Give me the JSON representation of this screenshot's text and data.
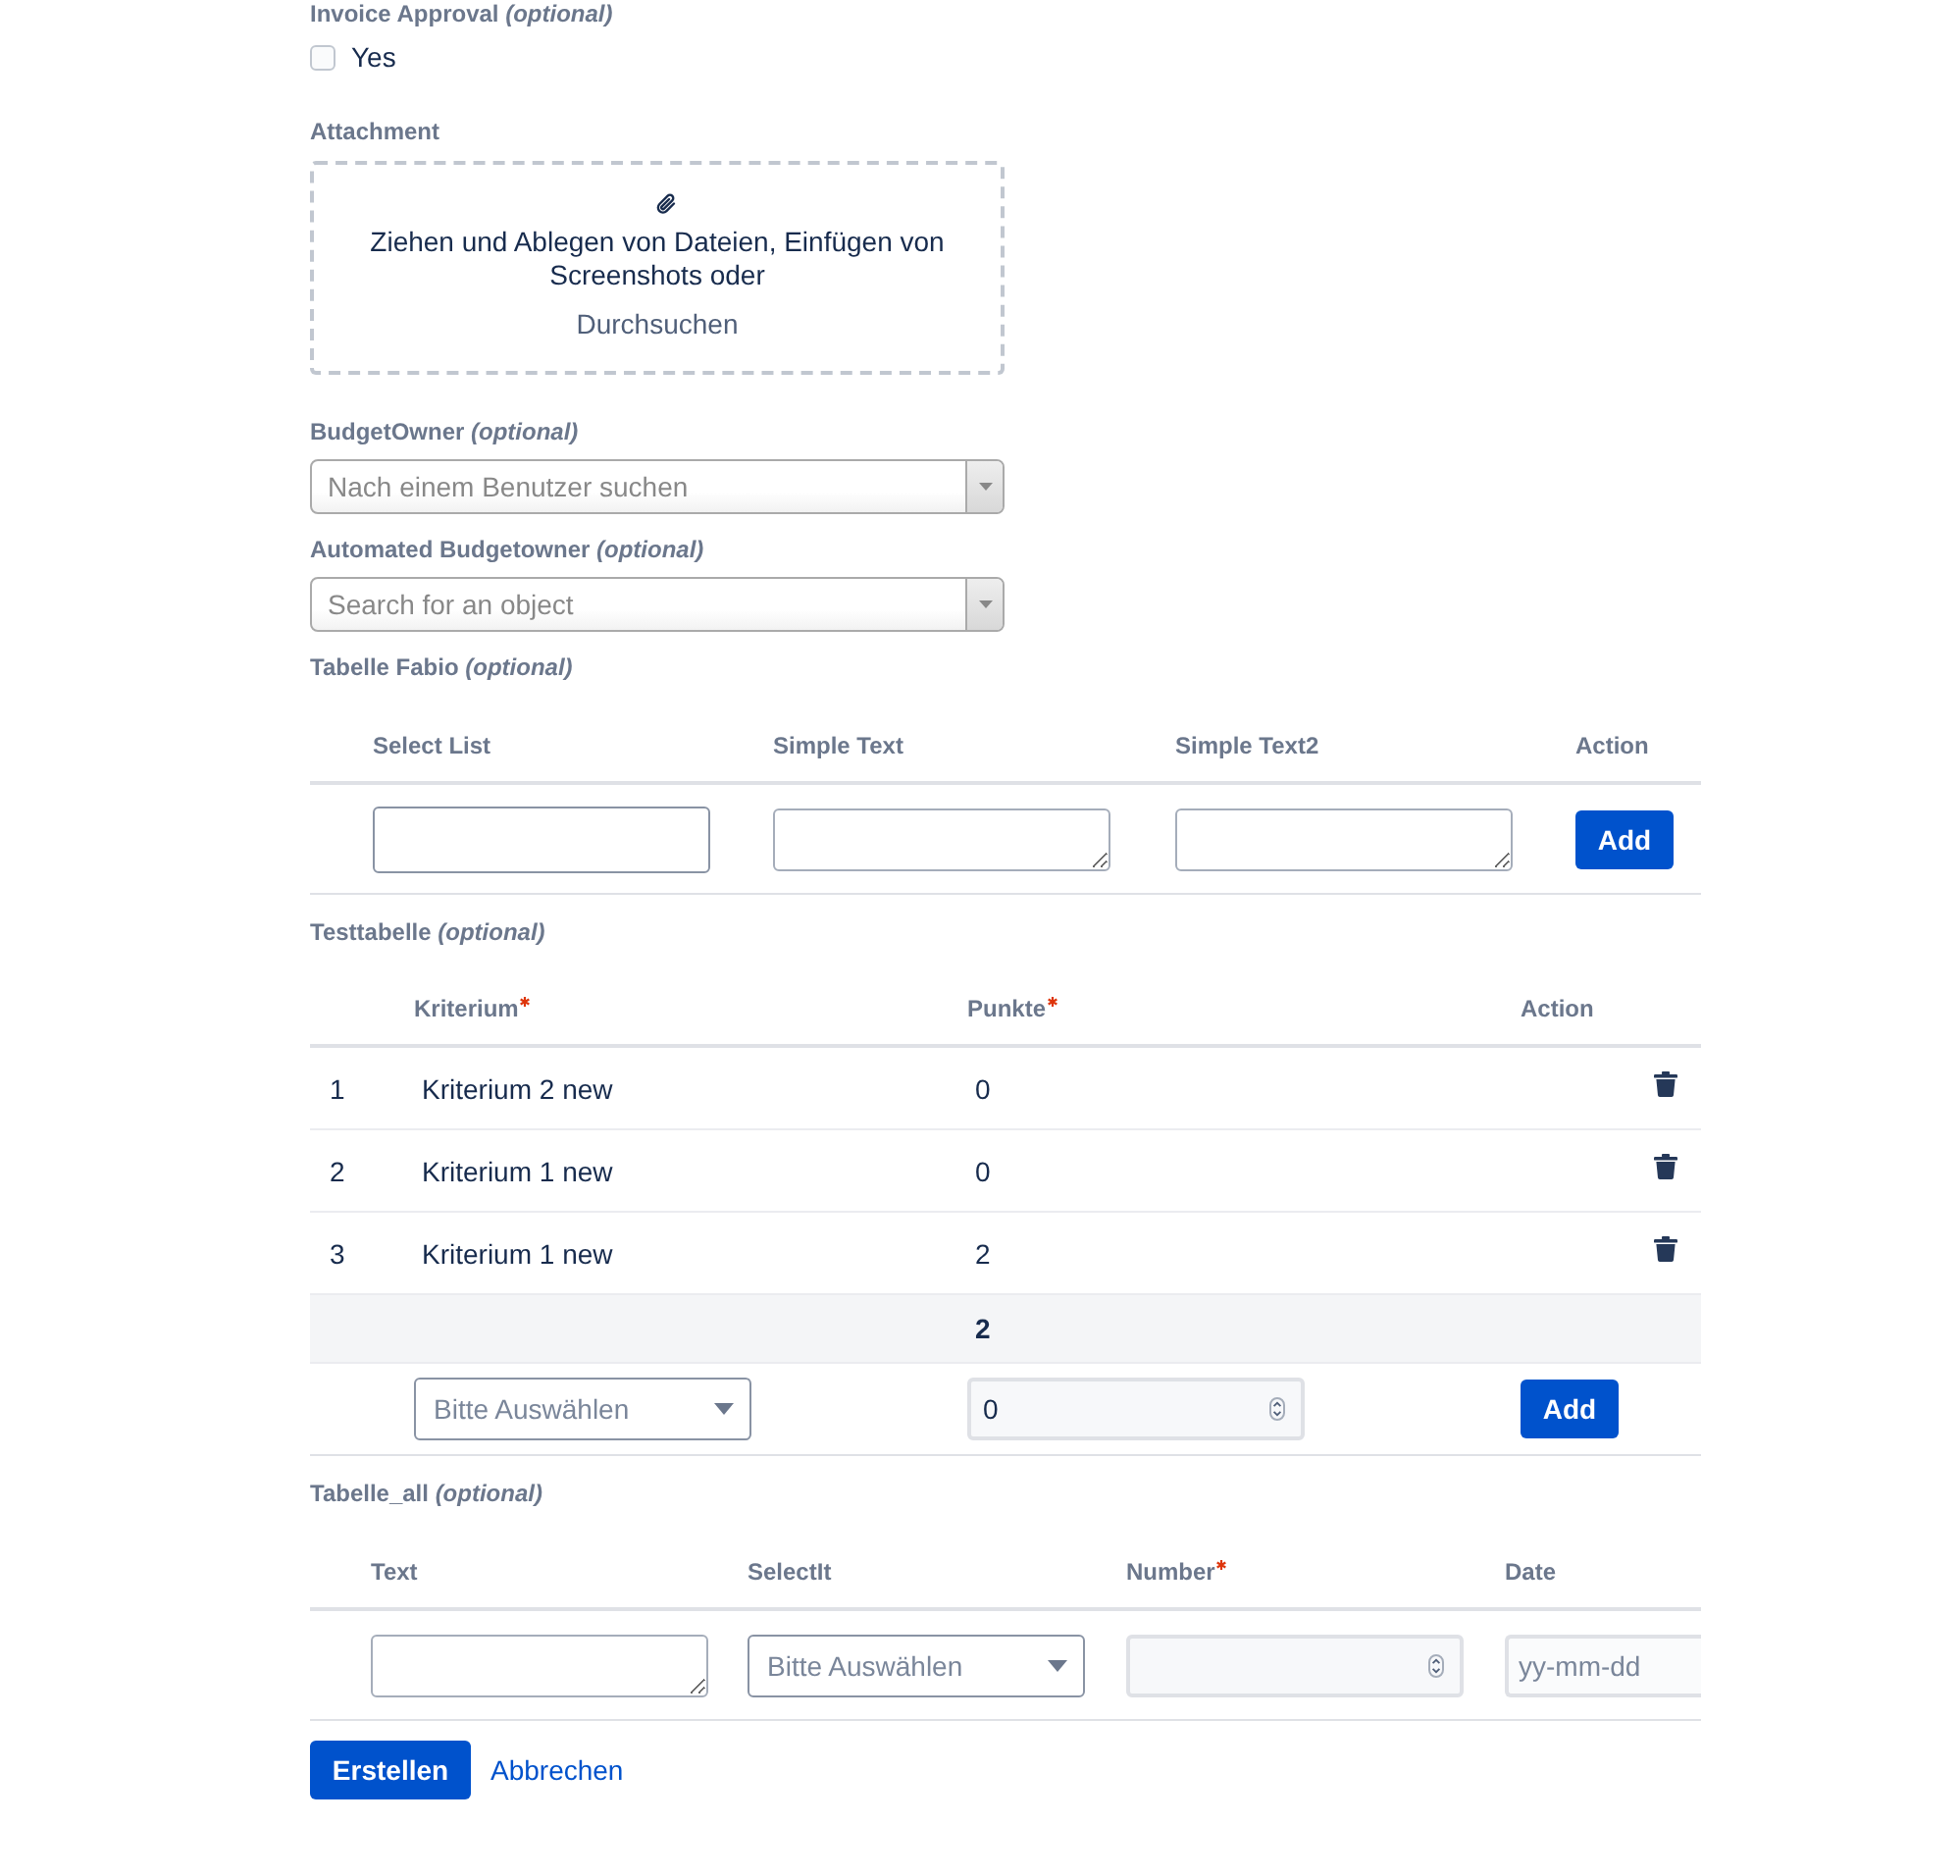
{
  "invoice_approval": {
    "label": "Invoice Approval *(optional)*",
    "option": {
      "label": "Yes",
      "checked": false
    }
  },
  "attachment": {
    "label": "Attachment",
    "drop_text": "Ziehen und Ablegen von Dateien, Einfügen von Screenshots oder",
    "browse_link": "Durchsuchen"
  },
  "budget_owner": {
    "label": "BudgetOwner *(optional)*",
    "placeholder": "Nach einem Benutzer suchen"
  },
  "automated_budgetowner": {
    "label": "Automated Budgetowner *(optional)*",
    "placeholder": "Search for an object"
  },
  "tabelle_fabio": {
    "label": "Tabelle Fabio *(optional)*",
    "columns": [
      {
        "title": "Select List",
        "required": false
      },
      {
        "title": "Simple Text",
        "required": false
      },
      {
        "title": "Simple Text2",
        "required": false
      },
      {
        "title": "Action",
        "required": false
      }
    ],
    "new_row": {
      "cells": [
        {
          "kind": "input"
        },
        {
          "kind": "textarea"
        },
        {
          "kind": "textarea"
        }
      ],
      "add_button": "Add"
    }
  },
  "testtabelle": {
    "label": "Testtabelle *(optional)*",
    "columns": [
      {
        "title": "Kriterium",
        "required": true
      },
      {
        "title": "Punkte",
        "required": true
      },
      {
        "title": "Action",
        "required": false
      }
    ],
    "rows": [
      {
        "index": "1",
        "criterion": "Kriterium 2 new",
        "points": "0"
      },
      {
        "index": "2",
        "criterion": "Kriterium 1 new",
        "points": "0"
      },
      {
        "index": "3",
        "criterion": "Kriterium 1 new",
        "points": "2"
      }
    ],
    "total": "2",
    "new_row": {
      "cells": [
        {
          "kind": "select",
          "placeholder": "Bitte Auswählen"
        },
        {
          "kind": "number",
          "value": "0"
        }
      ],
      "add_button": "Add"
    }
  },
  "tabelle_all": {
    "label": "Tabelle_all *(optional)*",
    "columns": [
      {
        "title": "Text",
        "required": false
      },
      {
        "title": "SelectIt",
        "required": false
      },
      {
        "title": "Number",
        "required": true
      },
      {
        "title": "Date",
        "required": false
      }
    ],
    "new_row": {
      "cells": [
        {
          "kind": "textarea"
        },
        {
          "kind": "select",
          "placeholder": "Bitte Auswählen"
        },
        {
          "kind": "number"
        },
        {
          "kind": "date",
          "placeholder": "yy-mm-dd"
        }
      ]
    }
  },
  "actions": {
    "submit": "Erstellen",
    "cancel": "Abbrechen"
  }
}
